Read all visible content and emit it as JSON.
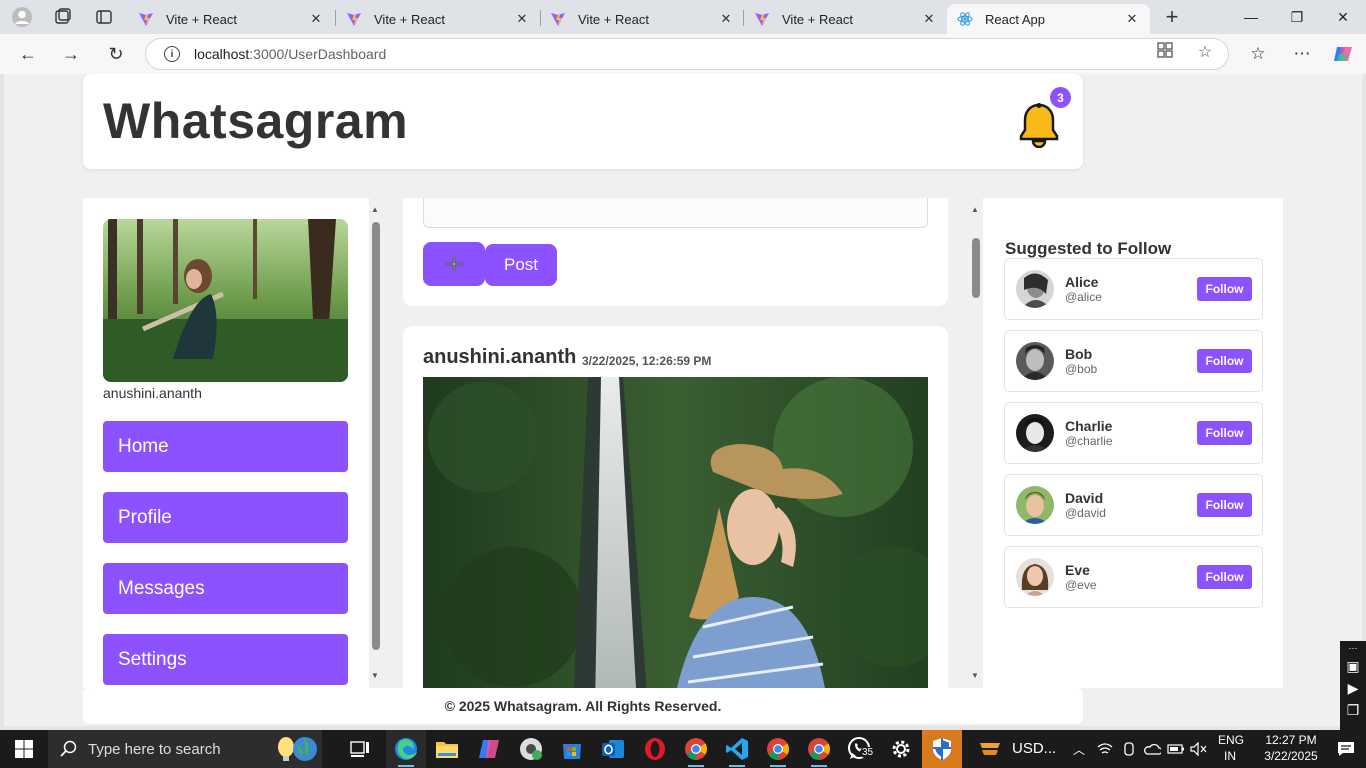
{
  "browser": {
    "tabs": [
      {
        "title": "Vite + React",
        "active": false
      },
      {
        "title": "Vite + React",
        "active": false
      },
      {
        "title": "Vite + React",
        "active": false
      },
      {
        "title": "Vite + React",
        "active": false
      },
      {
        "title": "React App",
        "active": true
      }
    ],
    "address": {
      "host": "localhost",
      "path": ":3000/UserDashboard"
    }
  },
  "app": {
    "logo": "Whatsagram",
    "notification_count": "3",
    "accent": "#8c52ff"
  },
  "sidebar": {
    "username": "anushini.ananth",
    "nav": [
      "Home",
      "Profile",
      "Messages",
      "Settings"
    ]
  },
  "composer": {
    "add_icon": "plus-icon",
    "post_label": "Post"
  },
  "post": {
    "author": "anushini.ananth",
    "timestamp": "3/22/2025, 12:26:59 PM"
  },
  "suggestions": {
    "title": "Suggested to Follow",
    "follow_label": "Follow",
    "users": [
      {
        "name": "Alice",
        "handle": "@alice"
      },
      {
        "name": "Bob",
        "handle": "@bob"
      },
      {
        "name": "Charlie",
        "handle": "@charlie"
      },
      {
        "name": "David",
        "handle": "@david"
      },
      {
        "name": "Eve",
        "handle": "@eve"
      }
    ]
  },
  "footer": "© 2025 Whatsagram. All Rights Reserved.",
  "taskbar": {
    "search_placeholder": "Type here to search",
    "weather": "USD...",
    "whatsapp_badge": "35",
    "lang_top": "ENG",
    "lang_bottom": "IN",
    "time": "12:27 PM",
    "date": "3/22/2025"
  }
}
